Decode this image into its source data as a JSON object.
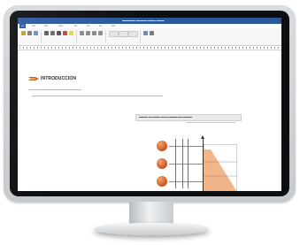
{
  "heading": {
    "title": "INTRODUCCION"
  }
}
